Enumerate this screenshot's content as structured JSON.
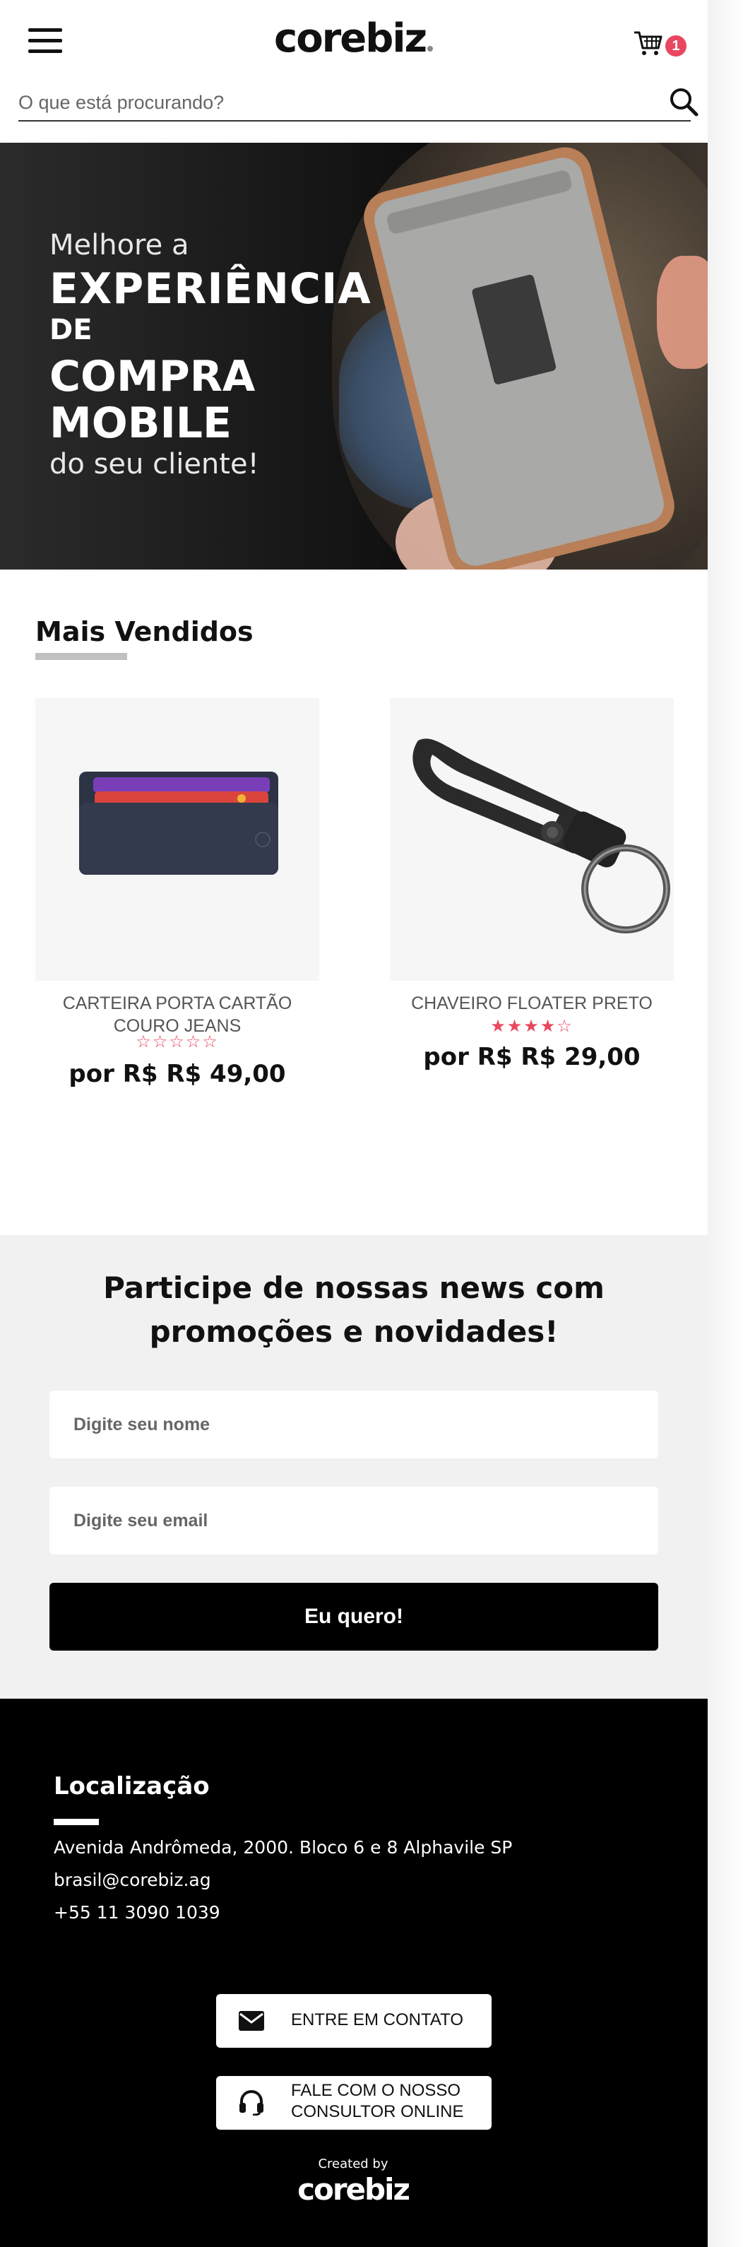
{
  "header": {
    "logo": "corebiz",
    "cart_count": "1"
  },
  "search": {
    "placeholder": "O que está procurando?"
  },
  "banner": {
    "line1": "Melhore a",
    "line2": "EXPERIÊNCIA",
    "line3": "DE",
    "line4": "COMPRA",
    "line5": "MOBILE",
    "line6": "do seu cliente!",
    "slides": 3,
    "active_slide": 2
  },
  "best_sellers": {
    "title": "Mais Vendidos",
    "products": [
      {
        "name": "CARTEIRA PORTA CARTÃO COURO JEANS",
        "rating": 0,
        "stars": "☆☆☆☆☆",
        "price": "por R$ R$ 49,00"
      },
      {
        "name": "CHAVEIRO FLOATER PRETO",
        "rating": 4,
        "stars": "★★★★☆",
        "price": "por R$ R$ 29,00"
      }
    ]
  },
  "newsletter": {
    "title": "Participe de nossas news com promoções e novidades!",
    "name_placeholder": "Digite seu nome",
    "email_placeholder": "Digite seu email",
    "submit_label": "Eu quero!"
  },
  "footer": {
    "title": "Localização",
    "address": "Avenida Andrômeda, 2000. Bloco 6 e 8 Alphavile SP",
    "email": "brasil@corebiz.ag",
    "phone": "+55 11 3090 1039",
    "contact_button": "ENTRE EM CONTATO",
    "consultant_button": "FALE COM O NOSSO CONSULTOR ONLINE",
    "created_by": "Created by",
    "logo": "corebiz"
  },
  "colors": {
    "accent": "#e8475f",
    "footer_bg": "#000000",
    "newsletter_bg": "#f1f1f1"
  }
}
